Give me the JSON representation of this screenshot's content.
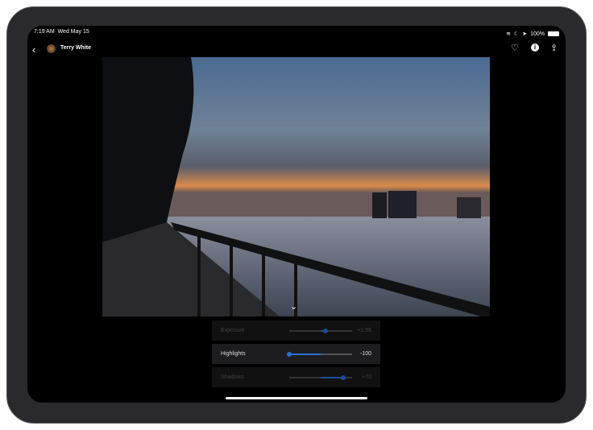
{
  "status": {
    "time": "7:19 AM",
    "date": "Wed May 15",
    "battery": "100%"
  },
  "topbar": {
    "user": "Terry White"
  },
  "sliders": [
    {
      "label": "Exposure",
      "value": "+1.55",
      "position": 0.58,
      "state": "dim"
    },
    {
      "label": "Highlights",
      "value": "-100",
      "position": 0.0,
      "state": "active"
    },
    {
      "label": "Shadows",
      "value": "+70",
      "position": 0.86,
      "state": "dim"
    }
  ],
  "colors": {
    "accent": "#2a6fd6"
  }
}
